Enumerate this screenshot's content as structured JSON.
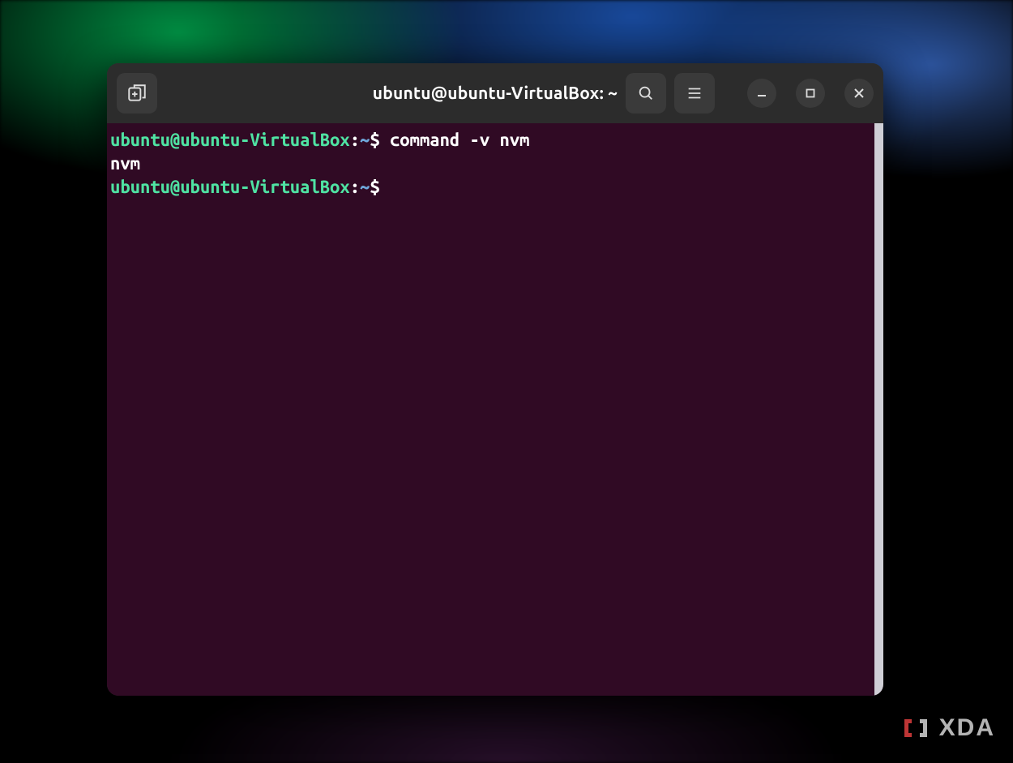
{
  "window": {
    "title": "ubuntu@ubuntu-VirtualBox: ~"
  },
  "prompt": {
    "user_host": "ubuntu@ubuntu-VirtualBox",
    "colon": ":",
    "path": "~",
    "symbol": "$"
  },
  "terminal": {
    "lines": [
      {
        "type": "prompt",
        "command": "command -v nvm"
      },
      {
        "type": "output",
        "text": "nvm"
      },
      {
        "type": "prompt",
        "command": ""
      }
    ]
  },
  "colors": {
    "term_bg": "#300a24",
    "prompt_user": "#4fe3a3",
    "prompt_path": "#6fa8dc",
    "titlebar_bg": "#2c2c2c"
  },
  "watermark": {
    "text": "XDA"
  }
}
